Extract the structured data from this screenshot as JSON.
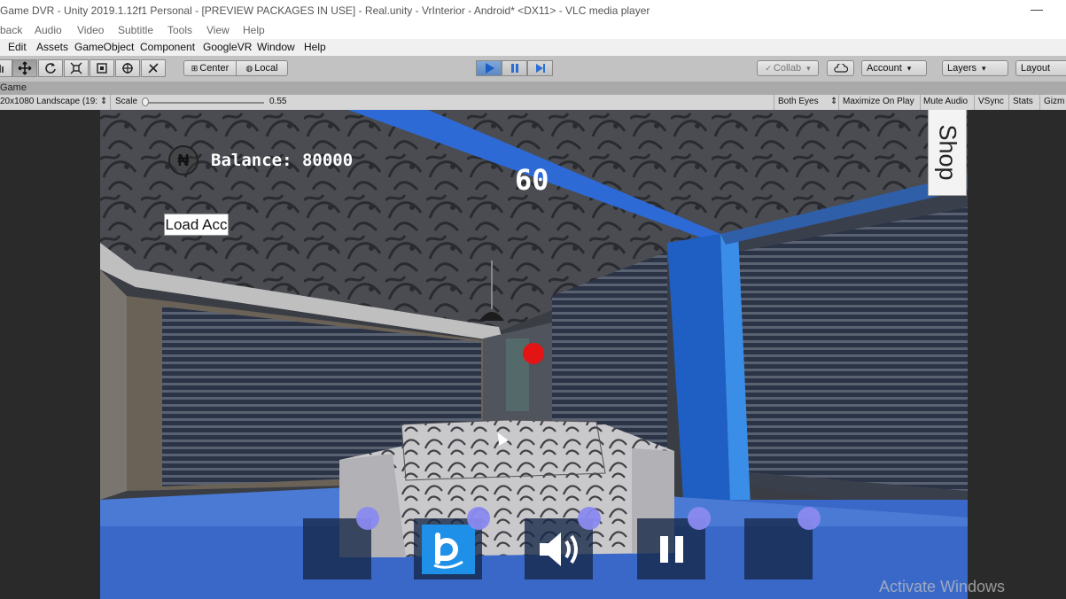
{
  "window": {
    "title": "Game DVR - Unity 2019.1.12f1 Personal - [PREVIEW PACKAGES IN USE] - Real.unity - VrInterior - Android* <DX11> - VLC media player",
    "minimize_glyph": "—"
  },
  "vlc_menu": [
    "back",
    "Audio",
    "Video",
    "Subtitle",
    "Tools",
    "View",
    "Help"
  ],
  "unity_menu": [
    "Edit",
    "Assets",
    "GameObject",
    "Component",
    "GoogleVR",
    "Window",
    "Help"
  ],
  "toolbar": {
    "tools": [
      "hand-tool-icon",
      "move-tool-icon",
      "rotate-tool-icon",
      "scale-tool-icon",
      "rect-tool-icon",
      "transform-tool-icon",
      "custom-tool-icon"
    ],
    "center_label": "Center",
    "local_label": "Local",
    "collab_label": "Collab",
    "account_label": "Account",
    "layers_label": "Layers",
    "layout_label": "Layout"
  },
  "game_tab": {
    "label": "Game"
  },
  "game_bar": {
    "resolution": "20x1080 Landscape (19:",
    "scale_label": "Scale",
    "scale_value": "0.55",
    "both_eyes": "Both Eyes",
    "maximize_on_play": "Maximize On Play",
    "mute_audio": "Mute Audio",
    "vsync": "VSync",
    "stats": "Stats",
    "gizmos": "Gizm"
  },
  "game_ui": {
    "coin_symbol": "₦",
    "balance": "Balance: 80000",
    "timer": "60",
    "load_acc": "Load Acc",
    "shop": "Shop"
  },
  "bottom_bar": {
    "buttons": [
      "empty",
      "brand-b-icon",
      "speaker-icon",
      "pause-icon",
      "empty"
    ]
  },
  "watermark": "Activate Windows",
  "colors": {
    "play_active": "#5c88c2",
    "ball": "#e41414",
    "knob": "#8a8af0",
    "brand_tile": "#1e90e8"
  }
}
